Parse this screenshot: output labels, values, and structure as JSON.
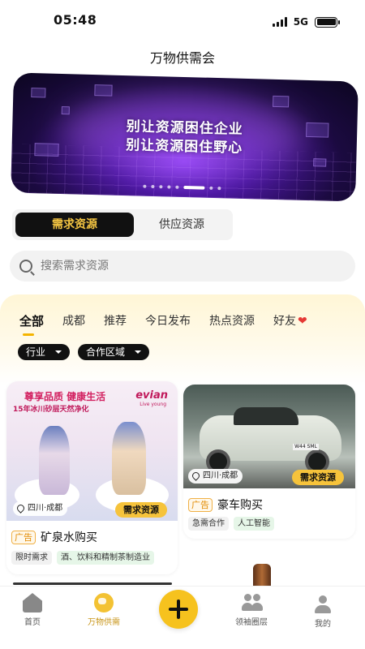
{
  "status_bar": {
    "time": "05:48",
    "network": "5G"
  },
  "page_title": "万物供需会",
  "banner": {
    "line1": "别让资源困住企业",
    "line2": "别让资源困住野心",
    "slide_count": 8,
    "active_slide": 6
  },
  "tabs": [
    {
      "label": "需求资源",
      "active": true
    },
    {
      "label": "供应资源",
      "active": false
    }
  ],
  "search": {
    "placeholder": "搜索需求资源"
  },
  "categories": [
    {
      "label": "全部",
      "active": true
    },
    {
      "label": "成都"
    },
    {
      "label": "推荐"
    },
    {
      "label": "今日发布"
    },
    {
      "label": "热点资源"
    },
    {
      "label": "好友",
      "icon": "heart-icon"
    }
  ],
  "filters": [
    {
      "label": "行业"
    },
    {
      "label": "合作区域"
    }
  ],
  "cards": [
    {
      "ad_image": {
        "headline": "尊享品质 健康生活",
        "subline": "15年冰川砂层天然净化",
        "brand": "evian",
        "brand_sub": "Live young"
      },
      "location": "四川·成都",
      "badge": "需求资源",
      "ad_label": "广告",
      "title": "矿泉水购买",
      "tags": [
        "限时需求",
        "酒、饮料和精制茶制造业"
      ]
    },
    {
      "plate": "W44 SML",
      "location": "四川·成都",
      "badge": "需求资源",
      "ad_label": "广告",
      "title": "豪车购买",
      "tags": [
        "急需合作",
        "人工智能"
      ]
    }
  ],
  "bottom_nav": [
    {
      "label": "首页",
      "icon": "home-icon"
    },
    {
      "label": "万物供需",
      "icon": "globe-icon",
      "active": true
    },
    {
      "label": "",
      "icon": "plus-icon"
    },
    {
      "label": "领袖圈层",
      "icon": "people-icon"
    },
    {
      "label": "我的",
      "icon": "user-icon"
    }
  ],
  "colors": {
    "accent": "#f6c21e",
    "dark": "#111111",
    "ad_orange": "#e28a00",
    "heart": "#e53935"
  }
}
